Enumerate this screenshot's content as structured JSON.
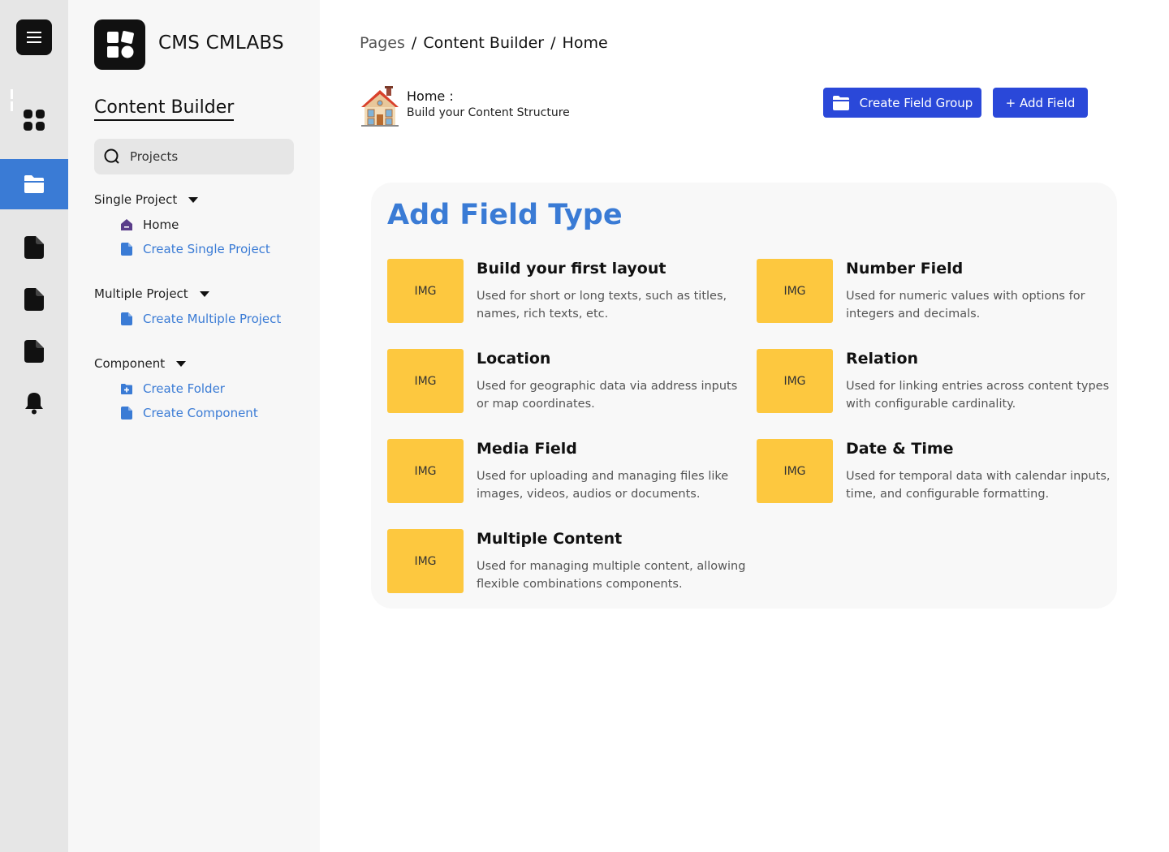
{
  "brand": {
    "name": "CMS CMLABS"
  },
  "sidebar": {
    "title": "Content Builder",
    "search_placeholder": "Projects",
    "groups": [
      {
        "label": "Single Project",
        "items": [
          {
            "label": "Home",
            "icon": "home-icon"
          },
          {
            "label": "Create Single Project",
            "icon": "file-icon"
          }
        ]
      },
      {
        "label": "Multiple Project",
        "items": [
          {
            "label": "Create Multiple Project",
            "icon": "file-icon"
          }
        ]
      },
      {
        "label": "Component",
        "items": [
          {
            "label": "Create Folder",
            "icon": "folder-plus-icon"
          },
          {
            "label": "Create Component",
            "icon": "file-icon"
          }
        ]
      }
    ]
  },
  "rail": {
    "items": [
      "menu-icon",
      "dashboard-icon",
      "folder-icon",
      "file-icon",
      "file-icon",
      "file-icon",
      "bell-icon"
    ],
    "active": "folder-icon"
  },
  "breadcrumb": [
    "Pages",
    "Content Builder",
    "Home"
  ],
  "breadcrumb_sep": "/",
  "header": {
    "title": "Home :",
    "subtitle": "Build your Content Structure"
  },
  "buttons": {
    "create_group": "Create Field Group",
    "add_field": "+ Add Field"
  },
  "panel": {
    "title": "Add Field Type",
    "cards": [
      {
        "thumb": "IMG",
        "title": "Build your first layout",
        "desc": "Used for short or long texts, such as titles, names, rich texts, etc."
      },
      {
        "thumb": "IMG",
        "title": "Number Field",
        "desc": "Used for numeric values with options for integers and decimals."
      },
      {
        "thumb": "IMG",
        "title": "Location",
        "desc": "Used for geographic data via address inputs or map coordinates."
      },
      {
        "thumb": "IMG",
        "title": "Relation",
        "desc": "Used for linking entries across content types with configurable cardinality."
      },
      {
        "thumb": "IMG",
        "title": "Media Field",
        "desc": "Used for uploading and managing files like images, videos, audios or documents."
      },
      {
        "thumb": "IMG",
        "title": "Date & Time",
        "desc": "Used for temporal data with calendar inputs, time, and configurable formatting."
      },
      {
        "thumb": "IMG",
        "title": "Multiple Content",
        "desc": "Used for managing multiple content, allowing flexible combinations components."
      }
    ]
  },
  "colors": {
    "accent": "#3a7bd5",
    "button": "#2a48d9",
    "thumb": "#fdc83f",
    "rail": "#e6e6e6",
    "sidebar": "#f7f7f7"
  }
}
